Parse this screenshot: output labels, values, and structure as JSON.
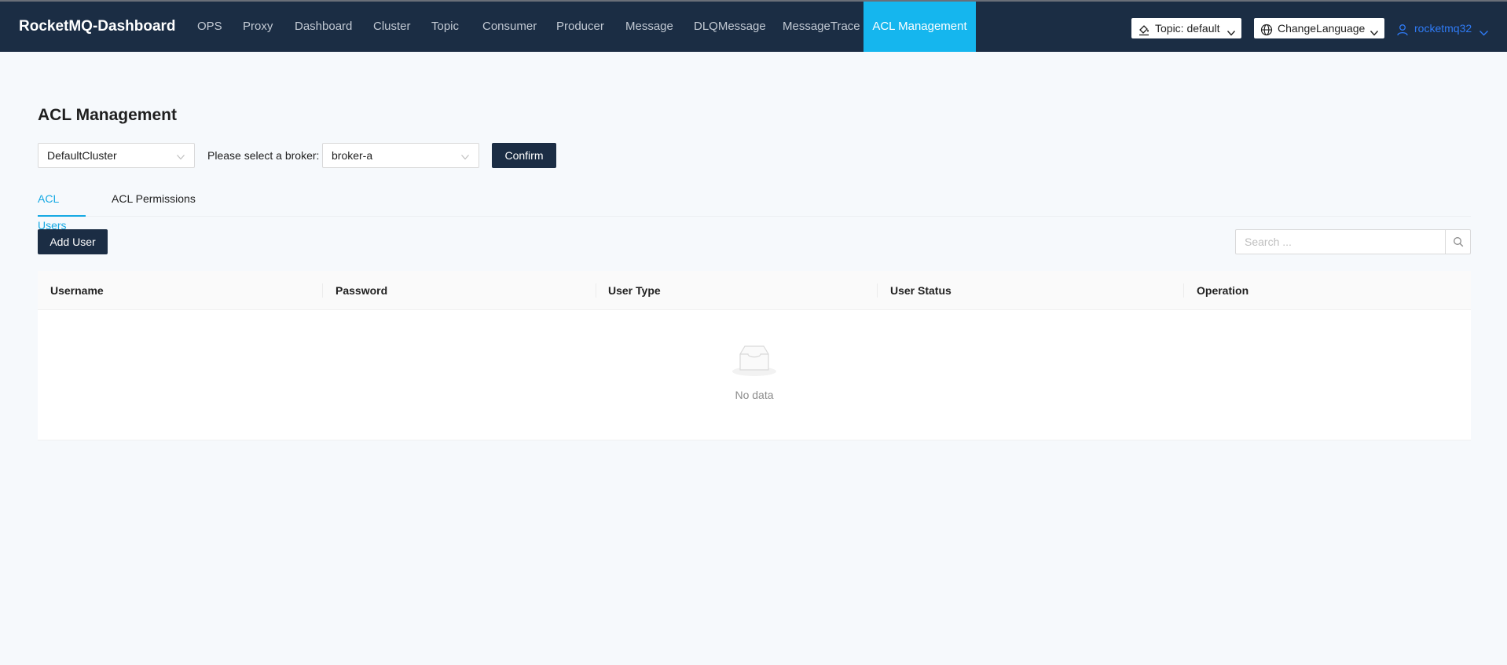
{
  "app": {
    "brand": "RocketMQ-Dashboard"
  },
  "nav": {
    "items": [
      {
        "label": "OPS"
      },
      {
        "label": "Proxy"
      },
      {
        "label": "Dashboard"
      },
      {
        "label": "Cluster"
      },
      {
        "label": "Topic"
      },
      {
        "label": "Consumer"
      },
      {
        "label": "Producer"
      },
      {
        "label": "Message"
      },
      {
        "label": "DLQMessage"
      },
      {
        "label": "MessageTrace"
      },
      {
        "label": "ACL Management"
      }
    ],
    "active": "ACL Management"
  },
  "header": {
    "topic_selector": {
      "label": "Topic: default",
      "icon": "paint-bucket-icon"
    },
    "language_selector": {
      "label": "ChangeLanguage",
      "icon": "globe-icon"
    },
    "user": {
      "name": "rocketmq32",
      "icon": "user-icon"
    }
  },
  "page": {
    "title": "ACL Management",
    "cluster_select": {
      "value": "DefaultCluster"
    },
    "broker_label": "Please select a broker:",
    "broker_select": {
      "value": "broker-a"
    },
    "confirm_label": "Confirm"
  },
  "tabs": [
    {
      "label": "ACL Users"
    },
    {
      "label": "ACL Permissions"
    }
  ],
  "active_tab": "ACL Users",
  "toolbar": {
    "add_user_label": "Add User",
    "search_placeholder": "Search ..."
  },
  "table": {
    "columns": [
      "Username",
      "Password",
      "User Type",
      "User Status",
      "Operation"
    ],
    "rows": [],
    "empty_text": "No data"
  },
  "colors": {
    "nav_bg": "#1b2d44",
    "accent": "#15b6ee",
    "user_link": "#2f7bf6"
  }
}
